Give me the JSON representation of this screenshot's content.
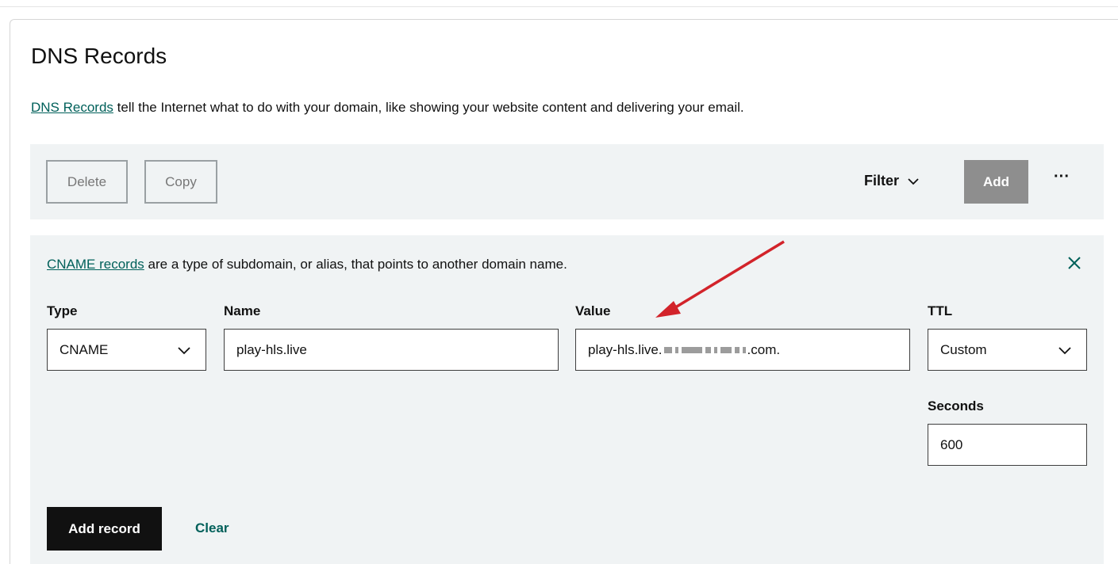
{
  "page": {
    "title": "DNS Records",
    "intro_link": "DNS Records",
    "intro_text": " tell the Internet what to do with your domain, like showing your website content and delivering your email."
  },
  "toolbar": {
    "delete_label": "Delete",
    "copy_label": "Copy",
    "filter_label": "Filter",
    "add_label": "Add",
    "more_label": "···"
  },
  "form": {
    "info_link": "CNAME records",
    "info_text": " are a type of subdomain, or alias, that points to another domain name.",
    "type_label": "Type",
    "type_value": "CNAME",
    "name_label": "Name",
    "name_value": "play-hls.live",
    "value_label": "Value",
    "value_prefix": "play-hls.live.",
    "value_suffix": ".com.",
    "ttl_label": "TTL",
    "ttl_value": "Custom",
    "seconds_label": "Seconds",
    "seconds_value": "600",
    "add_record_label": "Add record",
    "clear_label": "Clear"
  },
  "colors": {
    "link": "#00605a",
    "panel_bg": "#f0f3f4",
    "add_disabled": "#8e8e8e",
    "primary": "#111111",
    "annotation_arrow": "#d2232a"
  },
  "icons": {
    "filter": "chevron-down-icon",
    "close": "close-icon",
    "select": "chevron-down-icon"
  }
}
